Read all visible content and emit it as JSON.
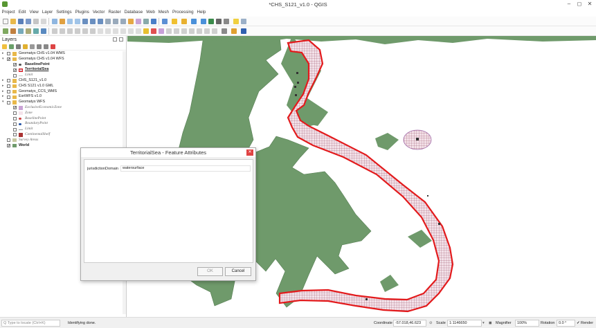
{
  "window": {
    "title": "*CHS_S121_v1.0 - QGIS"
  },
  "menu": [
    "Project",
    "Edit",
    "View",
    "Layer",
    "Settings",
    "Plugins",
    "Vector",
    "Raster",
    "Database",
    "Web",
    "Mesh",
    "Processing",
    "Help"
  ],
  "layers_panel": {
    "title": "Layers",
    "items": [
      {
        "label": "Geomatys CHS v1.04 WMS",
        "checked": false,
        "expand": "▸",
        "style": "normal"
      },
      {
        "label": "Geomatys CHS v1.04 WFS",
        "checked": true,
        "expand": "▾",
        "style": "normal"
      },
      {
        "label": "BaselinePoint",
        "checked": true,
        "expand": "",
        "style": "bold"
      },
      {
        "label": "TerritorialSea",
        "checked": true,
        "expand": "",
        "style": "bold-underline"
      },
      {
        "label": "Limit",
        "checked": false,
        "expand": "",
        "style": "italic"
      },
      {
        "label": "CHS_S121_v1.0",
        "checked": false,
        "expand": "▸",
        "style": "normal"
      },
      {
        "label": "CHS S121 v1.0 GML",
        "checked": false,
        "expand": "▸",
        "style": "normal"
      },
      {
        "label": "Geomatys_CCS_WMS",
        "checked": false,
        "expand": "▸",
        "style": "normal"
      },
      {
        "label": "EsriWFS v1.0",
        "checked": false,
        "expand": "▸",
        "style": "normal"
      },
      {
        "label": "Geomatys WFS",
        "checked": false,
        "expand": "▾",
        "style": "normal"
      },
      {
        "label": "ExclusiveEconomicZone",
        "checked": true,
        "expand": "",
        "style": "italic"
      },
      {
        "label": "Zone",
        "checked": false,
        "expand": "",
        "style": "italic"
      },
      {
        "label": "BaselinePoint",
        "checked": false,
        "expand": "",
        "style": "italic"
      },
      {
        "label": "BoundaryPoint",
        "checked": false,
        "expand": "",
        "style": "italic"
      },
      {
        "label": "Limit",
        "checked": false,
        "expand": "",
        "style": "italic"
      },
      {
        "label": "ContinentalShelf",
        "checked": false,
        "expand": "",
        "style": "italic"
      },
      {
        "label": "Survey Areas",
        "checked": false,
        "expand": "",
        "style": "italic"
      },
      {
        "label": "World",
        "checked": true,
        "expand": "",
        "style": "bold"
      }
    ]
  },
  "dialog": {
    "title": "TerritorialSea - Feature Attributes",
    "close": "✕",
    "attr_key": "jurisdictionDomain",
    "attr_value": "watersurface",
    "ok": "OK",
    "cancel": "Cancel"
  },
  "status": {
    "locate_placeholder": "Q  Type to locate (Ctrl+K)",
    "message": "Identifying done.",
    "coordinate_label": "Coordinate",
    "coordinate": "-57.018,46.623",
    "scale_label": "Scale",
    "scale": "1:1146650",
    "magnifier_label": "Magnifier",
    "magnifier": "100%",
    "rotation_label": "Rotation",
    "rotation": "0.0 °",
    "render": "Render"
  },
  "colors": {
    "land": "#6f9a6b",
    "territorial_sea_outline": "#e31a1c",
    "hatch": "#8c3a55",
    "zone_fill": "#dcc5e6"
  }
}
